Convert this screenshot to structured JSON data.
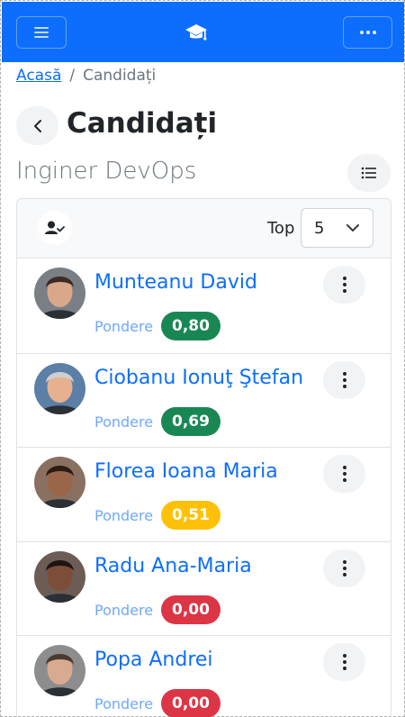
{
  "breadcrumb": {
    "home": "Acasă",
    "separator": "/",
    "current": "Candidați"
  },
  "page": {
    "title": "Candidați",
    "subtitle": "Inginer DevOps"
  },
  "filter": {
    "top_label": "Top",
    "top_value": "5"
  },
  "candidates": [
    {
      "name": "Munteanu David",
      "weight_label": "Pondere",
      "weight": "0,80",
      "badge_color": "#198754",
      "avatar_bg": "#7a7f86",
      "avatar_skin": "#d9a88a",
      "avatar_hair": "#3b2b22"
    },
    {
      "name": "Ciobanu Ionuţ Ştefan",
      "weight_label": "Pondere",
      "weight": "0,69",
      "badge_color": "#198754",
      "avatar_bg": "#5b7fa6",
      "avatar_skin": "#e7b18f",
      "avatar_hair": "#cfcfcf"
    },
    {
      "name": "Florea Ioana Maria",
      "weight_label": "Pondere",
      "weight": "0,51",
      "badge_color": "#ffc107",
      "avatar_bg": "#8a7060",
      "avatar_skin": "#9a6649",
      "avatar_hair": "#2a1b14"
    },
    {
      "name": "Radu Ana-Maria",
      "weight_label": "Pondere",
      "weight": "0,00",
      "badge_color": "#dc3545",
      "avatar_bg": "#6d5c55",
      "avatar_skin": "#7c4e3a",
      "avatar_hair": "#1e1512"
    },
    {
      "name": "Popa Andrei",
      "weight_label": "Pondere",
      "weight": "0,00",
      "badge_color": "#dc3545",
      "avatar_bg": "#8d8d8d",
      "avatar_skin": "#d8ab90",
      "avatar_hair": "#4a3a30"
    }
  ],
  "colors": {
    "primary": "#0d6efd",
    "success": "#198754",
    "warning": "#ffc107",
    "danger": "#dc3545"
  },
  "icons": {
    "menu": "hamburger-icon",
    "brand": "graduation-cap-icon",
    "more": "ellipsis-icon",
    "back": "chevron-left-icon",
    "list": "list-icon",
    "filter": "user-check-icon",
    "select": "chevron-down-icon",
    "row_menu": "kebab-icon"
  }
}
